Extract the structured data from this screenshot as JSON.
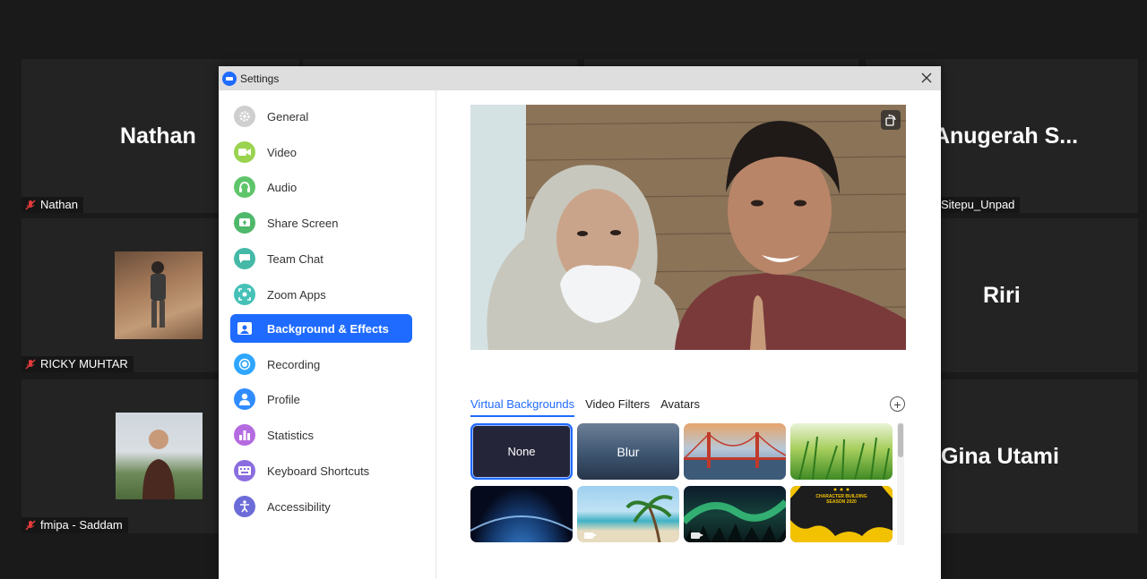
{
  "participants": [
    {
      "big_name": "Nathan",
      "label": "Nathan"
    },
    {
      "big_name": "i Anugerah S...",
      "label": "Sitepu_Unpad"
    },
    {
      "big_name": "",
      "label": "RICKY MUHTAR"
    },
    {
      "big_name": "Riri",
      "label": ""
    },
    {
      "big_name": "",
      "label": "fmipa - Saddam"
    },
    {
      "big_name": "Gina Utami",
      "label": ""
    }
  ],
  "window": {
    "title": "Settings",
    "logo_icon": "zoom-logo-icon",
    "close_icon": "close-icon"
  },
  "sidebar": {
    "items": [
      {
        "label": "General",
        "icon": "gear-icon",
        "color": "#cfcfcf"
      },
      {
        "label": "Video",
        "icon": "video-camera-icon",
        "color": "#9ad34f"
      },
      {
        "label": "Audio",
        "icon": "headphones-icon",
        "color": "#5fc56a"
      },
      {
        "label": "Share Screen",
        "icon": "share-screen-icon",
        "color": "#4fb86a"
      },
      {
        "label": "Team Chat",
        "icon": "chat-icon",
        "color": "#45b9a8"
      },
      {
        "label": "Zoom Apps",
        "icon": "apps-icon",
        "color": "#45c1b8"
      },
      {
        "label": "Background & Effects",
        "icon": "background-icon",
        "color": "#1f6bff",
        "active": true
      },
      {
        "label": "Recording",
        "icon": "recording-icon",
        "color": "#2ea6ff"
      },
      {
        "label": "Profile",
        "icon": "profile-icon",
        "color": "#2f8cff"
      },
      {
        "label": "Statistics",
        "icon": "statistics-icon",
        "color": "#b56be0"
      },
      {
        "label": "Keyboard Shortcuts",
        "icon": "keyboard-icon",
        "color": "#8a6ee0"
      },
      {
        "label": "Accessibility",
        "icon": "accessibility-icon",
        "color": "#6c6cd8"
      }
    ]
  },
  "tabs": [
    {
      "label": "Virtual Backgrounds",
      "active": true
    },
    {
      "label": "Video Filters"
    },
    {
      "label": "Avatars"
    }
  ],
  "backgrounds": [
    {
      "label": "None",
      "kind": "none",
      "selected": true
    },
    {
      "label": "Blur",
      "kind": "blur"
    },
    {
      "label": "",
      "kind": "golden-gate"
    },
    {
      "label": "",
      "kind": "grass"
    },
    {
      "label": "",
      "kind": "earth"
    },
    {
      "label": "",
      "kind": "beach",
      "video": true
    },
    {
      "label": "",
      "kind": "aurora",
      "video": true
    },
    {
      "label": "CHARACTER BUILDING\nSEASON 2020",
      "kind": "custom-banner"
    }
  ],
  "colors": {
    "accent": "#1f6bff"
  }
}
